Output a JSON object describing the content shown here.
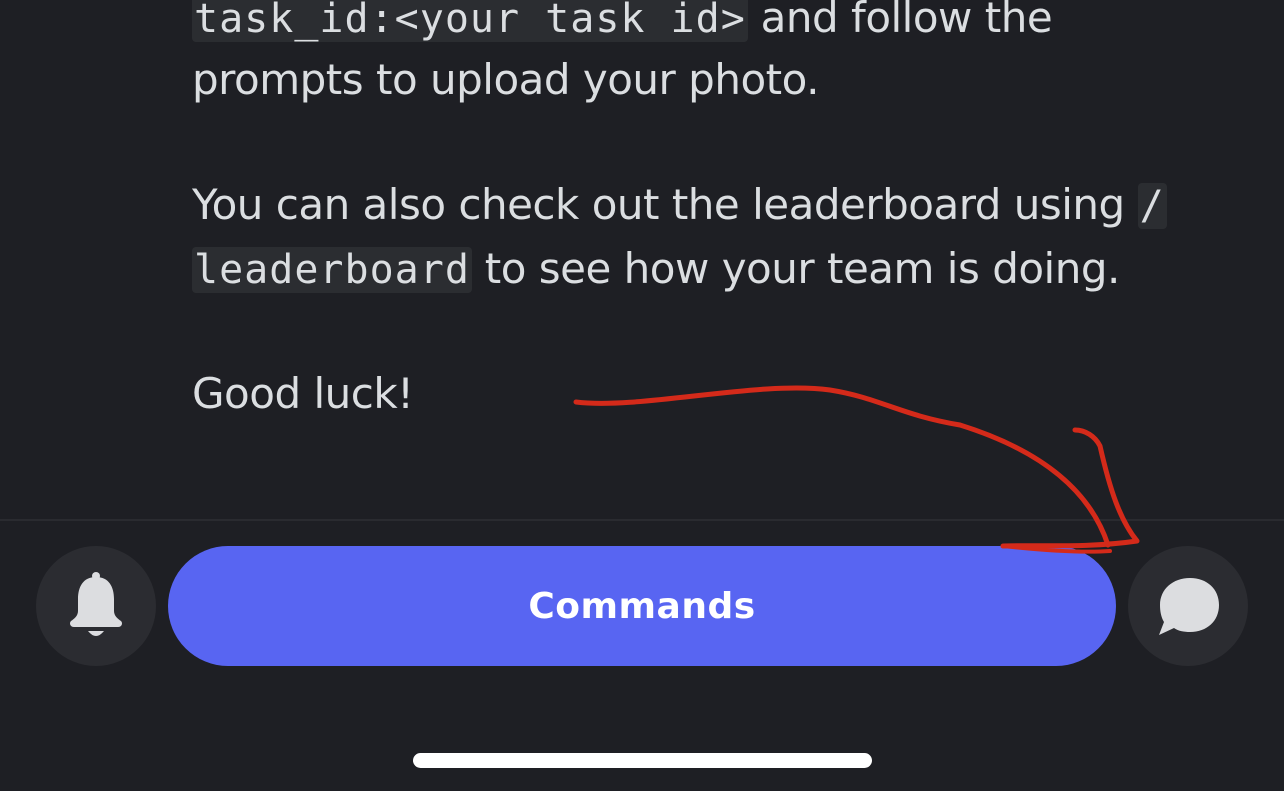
{
  "message": {
    "line1_code": "task_id:<your task id>",
    "line1_text": " and follow the",
    "line2_text": "prompts to upload your photo.",
    "line3_text": "You can also check out the leaderboard using ",
    "line3_code": "/",
    "line4_code": "leaderboard",
    "line4_text": " to see how your team is doing.",
    "line5_text": "Good luck!"
  },
  "bottom_bar": {
    "commands_label": "Commands",
    "left_icon": "bell-icon",
    "right_icon": "chat-bubble-icon"
  },
  "colors": {
    "background": "#1e1f24",
    "accent": "#5865f2",
    "annotation": "#d42a1a"
  }
}
